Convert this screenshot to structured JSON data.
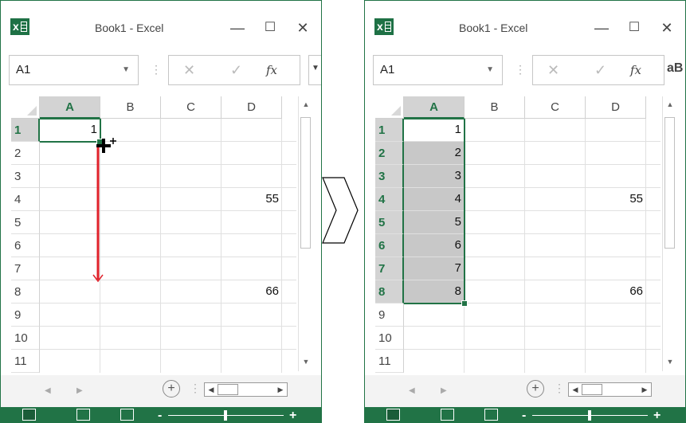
{
  "windows": [
    {
      "title": "Book1 - Excel",
      "app_icon": "excel-icon",
      "name_box": "A1",
      "columns": [
        "A",
        "B",
        "C",
        "D"
      ],
      "rows": [
        "1",
        "2",
        "3",
        "4",
        "5",
        "6",
        "7",
        "8",
        "9",
        "10",
        "11"
      ],
      "cells": [
        {
          "ref": "A1",
          "value": "1"
        },
        {
          "ref": "D4",
          "value": "55"
        },
        {
          "ref": "D8",
          "value": "66"
        }
      ],
      "state": "dragging fill handle"
    },
    {
      "title": "Book1 - Excel",
      "app_icon": "excel-icon",
      "name_box": "A1",
      "columns": [
        "A",
        "B",
        "C",
        "D"
      ],
      "rows": [
        "1",
        "2",
        "3",
        "4",
        "5",
        "6",
        "7",
        "8",
        "9",
        "10",
        "11"
      ],
      "cells": [
        {
          "ref": "A1",
          "value": "1"
        },
        {
          "ref": "A2",
          "value": "2"
        },
        {
          "ref": "A3",
          "value": "3"
        },
        {
          "ref": "A4",
          "value": "4"
        },
        {
          "ref": "A5",
          "value": "5"
        },
        {
          "ref": "A6",
          "value": "6"
        },
        {
          "ref": "A7",
          "value": "7"
        },
        {
          "ref": "A8",
          "value": "8"
        },
        {
          "ref": "D4",
          "value": "55"
        },
        {
          "ref": "D8",
          "value": "66"
        }
      ],
      "selected_range": "A1:A8"
    }
  ],
  "toolbar": {
    "minimize": "—",
    "maximize": "☐",
    "close": "✕",
    "cancel": "✕",
    "enter": "✓",
    "fx": "fx",
    "ribbon_peek": "aB"
  },
  "colors": {
    "excel_green": "#217346",
    "drag_arrow": "#e0202a",
    "fill_gray": "#c8c8c8"
  }
}
